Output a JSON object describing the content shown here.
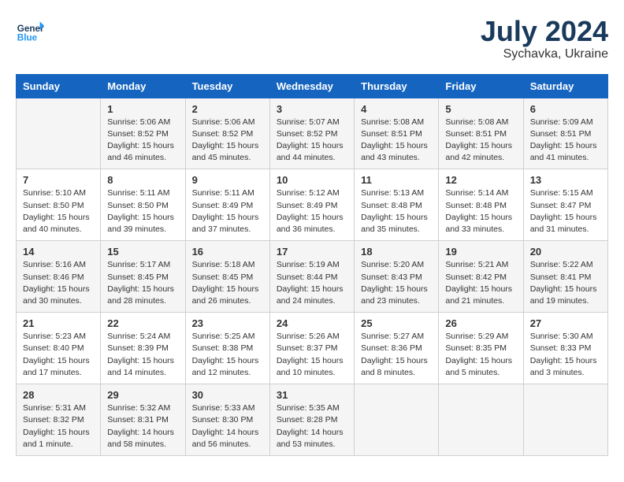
{
  "header": {
    "logo_general": "General",
    "logo_blue": "Blue",
    "month": "July 2024",
    "location": "Sychavka, Ukraine"
  },
  "columns": [
    "Sunday",
    "Monday",
    "Tuesday",
    "Wednesday",
    "Thursday",
    "Friday",
    "Saturday"
  ],
  "weeks": [
    [
      {
        "day": "",
        "info": ""
      },
      {
        "day": "1",
        "info": "Sunrise: 5:06 AM\nSunset: 8:52 PM\nDaylight: 15 hours\nand 46 minutes."
      },
      {
        "day": "2",
        "info": "Sunrise: 5:06 AM\nSunset: 8:52 PM\nDaylight: 15 hours\nand 45 minutes."
      },
      {
        "day": "3",
        "info": "Sunrise: 5:07 AM\nSunset: 8:52 PM\nDaylight: 15 hours\nand 44 minutes."
      },
      {
        "day": "4",
        "info": "Sunrise: 5:08 AM\nSunset: 8:51 PM\nDaylight: 15 hours\nand 43 minutes."
      },
      {
        "day": "5",
        "info": "Sunrise: 5:08 AM\nSunset: 8:51 PM\nDaylight: 15 hours\nand 42 minutes."
      },
      {
        "day": "6",
        "info": "Sunrise: 5:09 AM\nSunset: 8:51 PM\nDaylight: 15 hours\nand 41 minutes."
      }
    ],
    [
      {
        "day": "7",
        "info": "Sunrise: 5:10 AM\nSunset: 8:50 PM\nDaylight: 15 hours\nand 40 minutes."
      },
      {
        "day": "8",
        "info": "Sunrise: 5:11 AM\nSunset: 8:50 PM\nDaylight: 15 hours\nand 39 minutes."
      },
      {
        "day": "9",
        "info": "Sunrise: 5:11 AM\nSunset: 8:49 PM\nDaylight: 15 hours\nand 37 minutes."
      },
      {
        "day": "10",
        "info": "Sunrise: 5:12 AM\nSunset: 8:49 PM\nDaylight: 15 hours\nand 36 minutes."
      },
      {
        "day": "11",
        "info": "Sunrise: 5:13 AM\nSunset: 8:48 PM\nDaylight: 15 hours\nand 35 minutes."
      },
      {
        "day": "12",
        "info": "Sunrise: 5:14 AM\nSunset: 8:48 PM\nDaylight: 15 hours\nand 33 minutes."
      },
      {
        "day": "13",
        "info": "Sunrise: 5:15 AM\nSunset: 8:47 PM\nDaylight: 15 hours\nand 31 minutes."
      }
    ],
    [
      {
        "day": "14",
        "info": "Sunrise: 5:16 AM\nSunset: 8:46 PM\nDaylight: 15 hours\nand 30 minutes."
      },
      {
        "day": "15",
        "info": "Sunrise: 5:17 AM\nSunset: 8:45 PM\nDaylight: 15 hours\nand 28 minutes."
      },
      {
        "day": "16",
        "info": "Sunrise: 5:18 AM\nSunset: 8:45 PM\nDaylight: 15 hours\nand 26 minutes."
      },
      {
        "day": "17",
        "info": "Sunrise: 5:19 AM\nSunset: 8:44 PM\nDaylight: 15 hours\nand 24 minutes."
      },
      {
        "day": "18",
        "info": "Sunrise: 5:20 AM\nSunset: 8:43 PM\nDaylight: 15 hours\nand 23 minutes."
      },
      {
        "day": "19",
        "info": "Sunrise: 5:21 AM\nSunset: 8:42 PM\nDaylight: 15 hours\nand 21 minutes."
      },
      {
        "day": "20",
        "info": "Sunrise: 5:22 AM\nSunset: 8:41 PM\nDaylight: 15 hours\nand 19 minutes."
      }
    ],
    [
      {
        "day": "21",
        "info": "Sunrise: 5:23 AM\nSunset: 8:40 PM\nDaylight: 15 hours\nand 17 minutes."
      },
      {
        "day": "22",
        "info": "Sunrise: 5:24 AM\nSunset: 8:39 PM\nDaylight: 15 hours\nand 14 minutes."
      },
      {
        "day": "23",
        "info": "Sunrise: 5:25 AM\nSunset: 8:38 PM\nDaylight: 15 hours\nand 12 minutes."
      },
      {
        "day": "24",
        "info": "Sunrise: 5:26 AM\nSunset: 8:37 PM\nDaylight: 15 hours\nand 10 minutes."
      },
      {
        "day": "25",
        "info": "Sunrise: 5:27 AM\nSunset: 8:36 PM\nDaylight: 15 hours\nand 8 minutes."
      },
      {
        "day": "26",
        "info": "Sunrise: 5:29 AM\nSunset: 8:35 PM\nDaylight: 15 hours\nand 5 minutes."
      },
      {
        "day": "27",
        "info": "Sunrise: 5:30 AM\nSunset: 8:33 PM\nDaylight: 15 hours\nand 3 minutes."
      }
    ],
    [
      {
        "day": "28",
        "info": "Sunrise: 5:31 AM\nSunset: 8:32 PM\nDaylight: 15 hours\nand 1 minute."
      },
      {
        "day": "29",
        "info": "Sunrise: 5:32 AM\nSunset: 8:31 PM\nDaylight: 14 hours\nand 58 minutes."
      },
      {
        "day": "30",
        "info": "Sunrise: 5:33 AM\nSunset: 8:30 PM\nDaylight: 14 hours\nand 56 minutes."
      },
      {
        "day": "31",
        "info": "Sunrise: 5:35 AM\nSunset: 8:28 PM\nDaylight: 14 hours\nand 53 minutes."
      },
      {
        "day": "",
        "info": ""
      },
      {
        "day": "",
        "info": ""
      },
      {
        "day": "",
        "info": ""
      }
    ]
  ]
}
